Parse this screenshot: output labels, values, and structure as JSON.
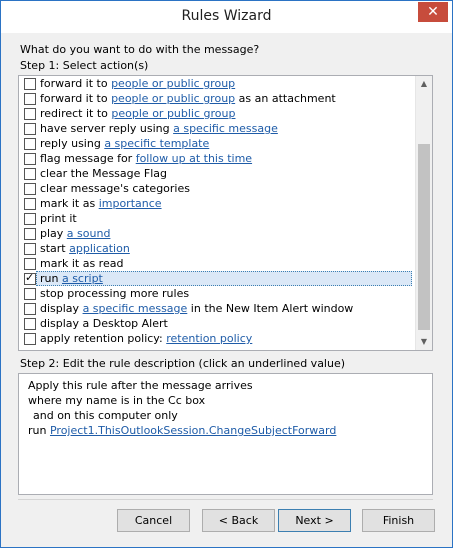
{
  "window": {
    "title": "Rules Wizard",
    "close_label": "✕"
  },
  "question": "What do you want to do with the message?",
  "step1_label": "Step 1: Select action(s)",
  "actions": [
    {
      "pre": "forward it to ",
      "link": "people or public group",
      "post": "",
      "checked": false
    },
    {
      "pre": "forward it to ",
      "link": "people or public group",
      "post": " as an attachment",
      "checked": false
    },
    {
      "pre": "redirect it to ",
      "link": "people or public group",
      "post": "",
      "checked": false
    },
    {
      "pre": "have server reply using ",
      "link": "a specific message",
      "post": "",
      "checked": false
    },
    {
      "pre": "reply using ",
      "link": "a specific template",
      "post": "",
      "checked": false
    },
    {
      "pre": "flag message for ",
      "link": "follow up at this time",
      "post": "",
      "checked": false
    },
    {
      "pre": "clear the Message Flag",
      "link": "",
      "post": "",
      "checked": false
    },
    {
      "pre": "clear message's categories",
      "link": "",
      "post": "",
      "checked": false
    },
    {
      "pre": "mark it as ",
      "link": "importance",
      "post": "",
      "checked": false
    },
    {
      "pre": "print it",
      "link": "",
      "post": "",
      "checked": false
    },
    {
      "pre": "play ",
      "link": "a sound",
      "post": "",
      "checked": false
    },
    {
      "pre": "start ",
      "link": "application",
      "post": "",
      "checked": false
    },
    {
      "pre": "mark it as read",
      "link": "",
      "post": "",
      "checked": false
    },
    {
      "pre": "run ",
      "link": "a script",
      "post": "",
      "checked": true
    },
    {
      "pre": "stop processing more rules",
      "link": "",
      "post": "",
      "checked": false
    },
    {
      "pre": "display ",
      "link": "a specific message",
      "post": " in the New Item Alert window",
      "checked": false
    },
    {
      "pre": "display a Desktop Alert",
      "link": "",
      "post": "",
      "checked": false
    },
    {
      "pre": "apply retention policy: ",
      "link": "retention policy",
      "post": "",
      "checked": false
    }
  ],
  "selected_action_index": 13,
  "step2_label": "Step 2: Edit the rule description (click an underlined value)",
  "description": {
    "line1": "Apply this rule after the message arrives",
    "line2": "where my name is in the Cc box",
    "line3": "and on this computer only",
    "line4_pre": "run ",
    "line4_link": "Project1.ThisOutlookSession.ChangeSubjectForward"
  },
  "buttons": {
    "cancel": "Cancel",
    "back": "< Back",
    "next": "Next >",
    "finish": "Finish"
  },
  "colors": {
    "link": "#1f5ca8",
    "selection": "#dbe8f7",
    "close_button": "#c74c3c",
    "border": "#2b73c4"
  }
}
